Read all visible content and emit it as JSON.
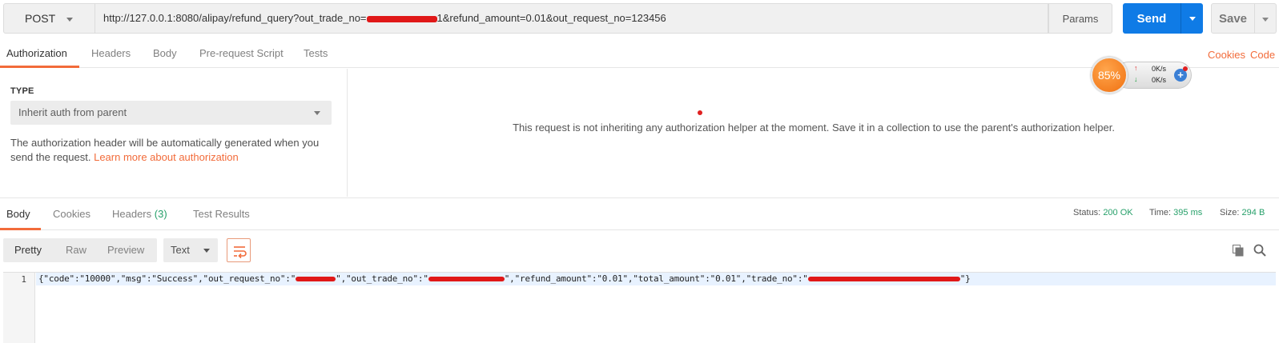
{
  "request": {
    "method": "POST",
    "url_prefix": "http://127.0.0.1:8080/alipay/refund_query?out_trade_no=",
    "url_suffix": "1&refund_amount=0.01&out_request_no=123456",
    "params_label": "Params",
    "send_label": "Send",
    "save_label": "Save"
  },
  "request_tabs": [
    "Authorization",
    "Headers",
    "Body",
    "Pre-request Script",
    "Tests"
  ],
  "right_links": {
    "cookies": "Cookies",
    "code": "Code"
  },
  "auth": {
    "type_label": "TYPE",
    "selected_type": "Inherit auth from parent",
    "help_text": "The authorization header will be automatically generated when you send the request.",
    "help_link": "Learn more about authorization",
    "message": "This request is not inheriting any authorization helper at the moment. Save it in a collection to use the parent's authorization helper."
  },
  "widget": {
    "percent": "85%",
    "up_rate": "0K/s",
    "down_rate": "0K/s"
  },
  "response_tabs": {
    "body": "Body",
    "cookies": "Cookies",
    "headers": "Headers",
    "headers_count": "(3)",
    "test_results": "Test Results"
  },
  "response_status": {
    "status_label": "Status:",
    "status_value": "200 OK",
    "time_label": "Time:",
    "time_value": "395 ms",
    "size_label": "Size:",
    "size_value": "294 B"
  },
  "view_modes": [
    "Pretty",
    "Raw",
    "Preview"
  ],
  "format": "Text",
  "code": {
    "line_number": "1",
    "part1": "{\"code\":\"10000\",\"msg\":\"Success\",\"out_request_no\":\"",
    "part2": "\",\"out_trade_no\":\"",
    "part3": "\",\"refund_amount\":\"0.01\",\"total_amount\":\"0.01\",\"trade_no\":\"",
    "part4": "\"}"
  }
}
